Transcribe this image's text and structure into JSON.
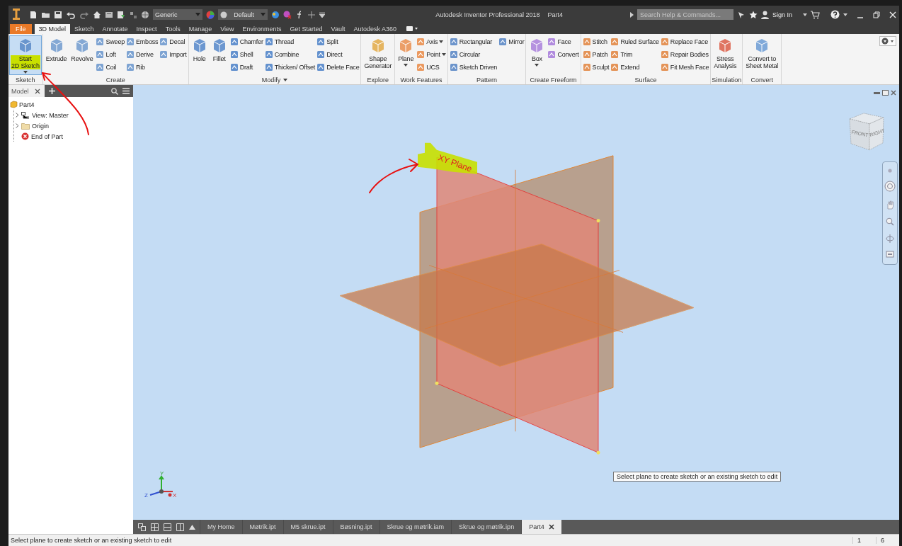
{
  "title_bar": {
    "quick_access": {
      "material": "Generic",
      "appearance": "Default"
    },
    "app_title": "Autodesk Inventor Professional 2018",
    "document_title": "Part4",
    "search": {
      "placeholder": "Search Help & Commands..."
    },
    "sign_in": "Sign In"
  },
  "tabs": [
    {
      "label": "File",
      "kind": "file",
      "selected": false
    },
    {
      "label": "3D Model",
      "kind": "tab",
      "selected": true
    },
    {
      "label": "Sketch",
      "kind": "tab",
      "selected": false
    },
    {
      "label": "Annotate",
      "kind": "tab",
      "selected": false
    },
    {
      "label": "Inspect",
      "kind": "tab",
      "selected": false
    },
    {
      "label": "Tools",
      "kind": "tab",
      "selected": false
    },
    {
      "label": "Manage",
      "kind": "tab",
      "selected": false
    },
    {
      "label": "View",
      "kind": "tab",
      "selected": false
    },
    {
      "label": "Environments",
      "kind": "tab",
      "selected": false
    },
    {
      "label": "Get Started",
      "kind": "tab",
      "selected": false
    },
    {
      "label": "Vault",
      "kind": "tab",
      "selected": false
    },
    {
      "label": "Autodesk A360",
      "kind": "tab",
      "selected": false
    }
  ],
  "ribbon": {
    "panels": [
      {
        "title": "Sketch",
        "tools": [
          {
            "kind": "large",
            "label": "Start\n2D Sketch",
            "highlighted": true,
            "dropdown": true
          }
        ]
      },
      {
        "title": "Create",
        "tools": [
          {
            "kind": "large",
            "label": "Extrude"
          },
          {
            "kind": "large",
            "label": "Revolve"
          },
          {
            "kind": "small",
            "label": "Sweep"
          },
          {
            "kind": "small",
            "label": "Loft"
          },
          {
            "kind": "small",
            "label": "Coil"
          },
          {
            "kind": "small",
            "label": "Emboss"
          },
          {
            "kind": "small",
            "label": "Derive"
          },
          {
            "kind": "small",
            "label": "Rib"
          },
          {
            "kind": "small",
            "label": "Decal"
          },
          {
            "kind": "small",
            "label": "Import"
          }
        ]
      },
      {
        "title": "Modify",
        "dropdown": true,
        "tools": [
          {
            "kind": "large",
            "label": "Hole"
          },
          {
            "kind": "large",
            "label": "Fillet"
          },
          {
            "kind": "small",
            "label": "Chamfer"
          },
          {
            "kind": "small",
            "label": "Shell"
          },
          {
            "kind": "small",
            "label": "Draft"
          },
          {
            "kind": "small",
            "label": "Thread"
          },
          {
            "kind": "small",
            "label": "Combine"
          },
          {
            "kind": "small",
            "label": "Thicken/ Offset"
          },
          {
            "kind": "small",
            "label": "Split"
          },
          {
            "kind": "small",
            "label": "Direct"
          },
          {
            "kind": "small",
            "label": "Delete Face"
          }
        ]
      },
      {
        "title": "Explore",
        "tools": [
          {
            "kind": "large",
            "label": "Shape\nGenerator"
          }
        ]
      },
      {
        "title": "Work Features",
        "tools": [
          {
            "kind": "large",
            "label": "Plane",
            "dropdown": true
          },
          {
            "kind": "small",
            "label": "Axis",
            "dropdown": true
          },
          {
            "kind": "small",
            "label": "Point",
            "dropdown": true
          },
          {
            "kind": "small",
            "label": "UCS"
          }
        ]
      },
      {
        "title": "Pattern",
        "tools": [
          {
            "kind": "small",
            "label": "Rectangular"
          },
          {
            "kind": "small",
            "label": "Circular"
          },
          {
            "kind": "small",
            "label": "Sketch Driven"
          },
          {
            "kind": "small",
            "label": "Mirror"
          }
        ]
      },
      {
        "title": "Create Freeform",
        "tools": [
          {
            "kind": "large",
            "label": "Box",
            "dropdown": true
          },
          {
            "kind": "small",
            "label": "Face"
          },
          {
            "kind": "small",
            "label": "Convert"
          }
        ]
      },
      {
        "title": "Surface",
        "tools": [
          {
            "kind": "small",
            "label": "Stitch"
          },
          {
            "kind": "small",
            "label": "Patch"
          },
          {
            "kind": "small",
            "label": "Sculpt"
          },
          {
            "kind": "small",
            "label": "Ruled Surface"
          },
          {
            "kind": "small",
            "label": "Trim"
          },
          {
            "kind": "small",
            "label": "Extend"
          },
          {
            "kind": "small",
            "label": "Replace Face"
          },
          {
            "kind": "small",
            "label": "Repair Bodies"
          },
          {
            "kind": "small",
            "label": "Fit Mesh Face"
          }
        ]
      },
      {
        "title": "Simulation",
        "tools": [
          {
            "kind": "large",
            "label": "Stress\nAnalysis"
          }
        ]
      },
      {
        "title": "Convert",
        "tools": [
          {
            "kind": "large",
            "label": "Convert to\nSheet Metal"
          }
        ]
      }
    ]
  },
  "browser": {
    "tab": "Model",
    "tree": [
      {
        "label": "Part4",
        "kind": "part",
        "children": [
          {
            "label": "View: Master",
            "kind": "view",
            "expanded": false
          },
          {
            "label": "Origin",
            "kind": "folder",
            "expanded": false
          },
          {
            "label": "End of Part",
            "kind": "end"
          }
        ]
      }
    ]
  },
  "viewport": {
    "plane_label": "XY Plane",
    "viewcube_faces": [
      "FRONT",
      "RIGHT"
    ],
    "triad": [
      "Y",
      "Z",
      "X"
    ],
    "tooltip": "Select plane to create sketch or an existing sketch to edit"
  },
  "document_tabs": [
    {
      "label": "My Home",
      "selected": false
    },
    {
      "label": "Møtrik.ipt",
      "selected": false
    },
    {
      "label": "M5 skrue.ipt",
      "selected": false
    },
    {
      "label": "Bøsning.ipt",
      "selected": false
    },
    {
      "label": "Skrue og møtrik.iam",
      "selected": false
    },
    {
      "label": "Skrue og møtrik.ipn",
      "selected": false
    },
    {
      "label": "Part4",
      "selected": true
    }
  ],
  "status_bar": {
    "message": "Select plane to create sketch or an existing sketch to edit",
    "fields": [
      "1",
      "6"
    ]
  }
}
